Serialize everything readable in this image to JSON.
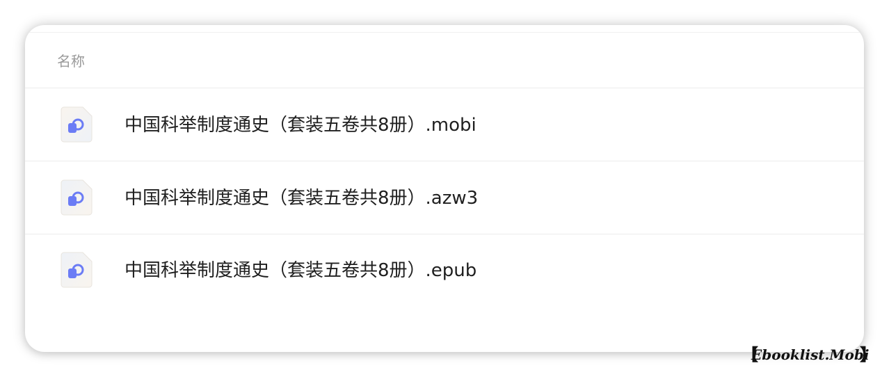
{
  "file_list": {
    "column_header": "名称",
    "files": [
      {
        "name": "中国科举制度通史（套装五卷共8册）.mobi",
        "icon": "ebook-file-icon"
      },
      {
        "name": "中国科举制度通史（套装五卷共8册）.azw3",
        "icon": "ebook-file-icon"
      },
      {
        "name": "中国科举制度通史（套装五卷共8册）.epub",
        "icon": "ebook-file-icon"
      }
    ]
  },
  "watermark": {
    "text": "Ebooklist.Mobi",
    "bracket_left": "【",
    "bracket_right": "】"
  },
  "colors": {
    "icon_accent": "#6b7cf5",
    "icon_bg": "#f7f3ee",
    "divider": "#ececec",
    "header_text": "#9a9a9a",
    "file_text": "#1f1f1f"
  }
}
